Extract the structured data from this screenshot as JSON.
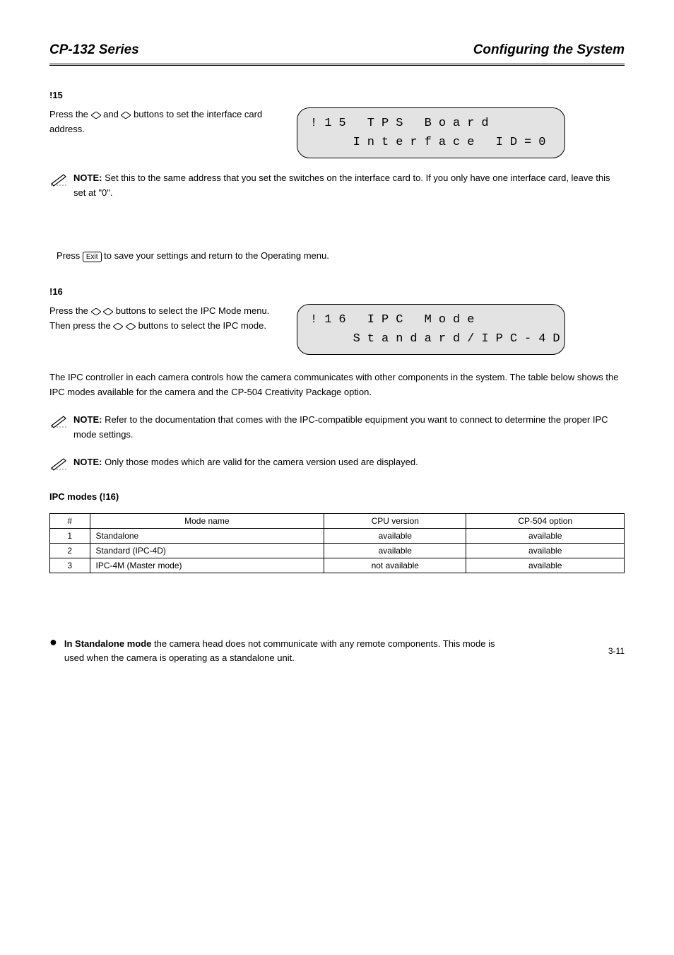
{
  "header": {
    "left": "CP-132 Series",
    "right": "Configuring the System"
  },
  "s15": {
    "num": "!15",
    "instr_pre": "Press the ",
    "instr_mid": " and ",
    "instr_post": " buttons to set the interface card address.",
    "lcd_l1": "!15 TPS Board",
    "lcd_l2": "   Interface ID=0",
    "note_label": "NOTE:",
    "note_text": " Set this to the same address that you set the switches on the interface card to. If you only have one interface card, leave this set at \"0\"."
  },
  "save_line": {
    "pre": "Press ",
    "exit": "Exit",
    "post": " to save your settings and return to the Operating menu."
  },
  "s16": {
    "num": "!16",
    "instr_l1a": "Press the ",
    "instr_l1b": " buttons to select the IPC Mode menu.",
    "instr_l2a": "Then press the ",
    "instr_l2b": " buttons to select the IPC mode.",
    "lcd_l1": "!16 IPC Mode",
    "lcd_l2": "   Standard/IPC-4D",
    "para": "The IPC controller in each camera controls how the camera communicates with other components in the system. The table below shows the IPC modes available for the camera and the CP-504 Creativity Package option.",
    "note1_label": "NOTE:",
    "note1_text": " Refer to the documentation that comes with the IPC-compatible equipment you want to connect to determine the proper IPC mode settings.",
    "note2_label": "NOTE:",
    "note2_text": " Only those modes which are valid for the camera version used are displayed.",
    "table_title": "IPC modes (!16)",
    "cols": {
      "c0": "#",
      "c1": "Mode name",
      "c2": "CPU version",
      "c3": "CP-504 option"
    },
    "rows": [
      {
        "n": "1",
        "name": "Standalone",
        "cpu": "available",
        "opt": "available"
      },
      {
        "n": "2",
        "name": "Standard (IPC-4D)",
        "cpu": "available",
        "opt": "available"
      },
      {
        "n": "3",
        "name": "IPC-4M (Master mode)",
        "cpu": "not available",
        "opt": "available"
      }
    ]
  },
  "bullet": {
    "head": "In Standalone mode ",
    "body": "the camera head does not communicate with any remote components. This mode is used when the camera is operating as a standalone unit."
  },
  "page_num": "3-11"
}
